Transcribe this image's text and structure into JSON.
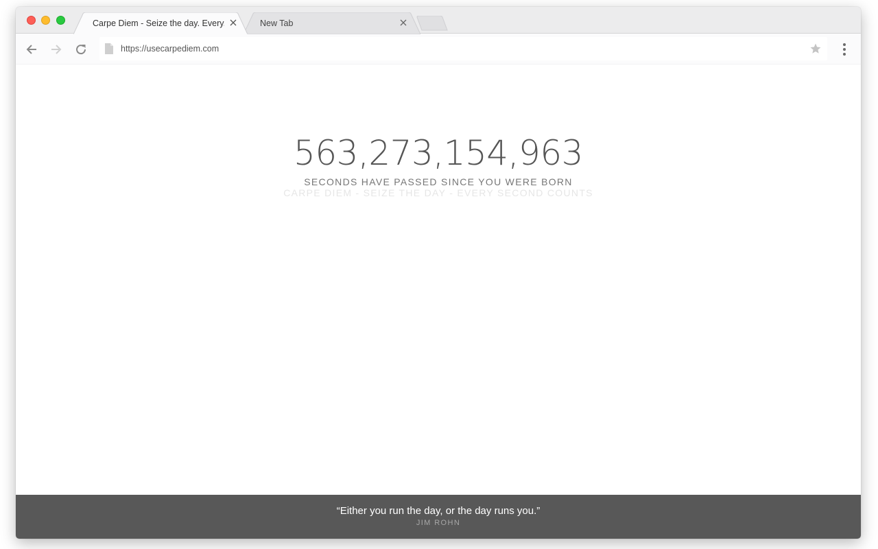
{
  "browser": {
    "tabs": [
      {
        "title": "Carpe Diem - Seize the day. Every...",
        "active": true
      },
      {
        "title": "New Tab",
        "active": false
      }
    ],
    "address_bar": {
      "url": "https://usecarpediem.com"
    },
    "icons": {
      "back": "arrow-left-icon",
      "forward": "arrow-right-icon",
      "reload": "reload-icon",
      "page": "document-icon",
      "bookmark": "star-icon",
      "menu": "kebab-menu-icon",
      "close_tab": "close-icon"
    }
  },
  "page": {
    "counter": "563,273,154,963",
    "counter_caption": "SECONDS HAVE PASSED SINCE YOU WERE BORN",
    "tagline": "CARPE DIEM - SEIZE THE DAY - EVERY SECOND COUNTS",
    "quote": {
      "text": "“Either you run the day, or the day runs you.”",
      "author": "JIM ROHN"
    }
  },
  "colors": {
    "quote_bar": "#585858",
    "counter_text": "#555555",
    "caption_text": "#777777",
    "tagline_text": "#e6e6e6"
  }
}
